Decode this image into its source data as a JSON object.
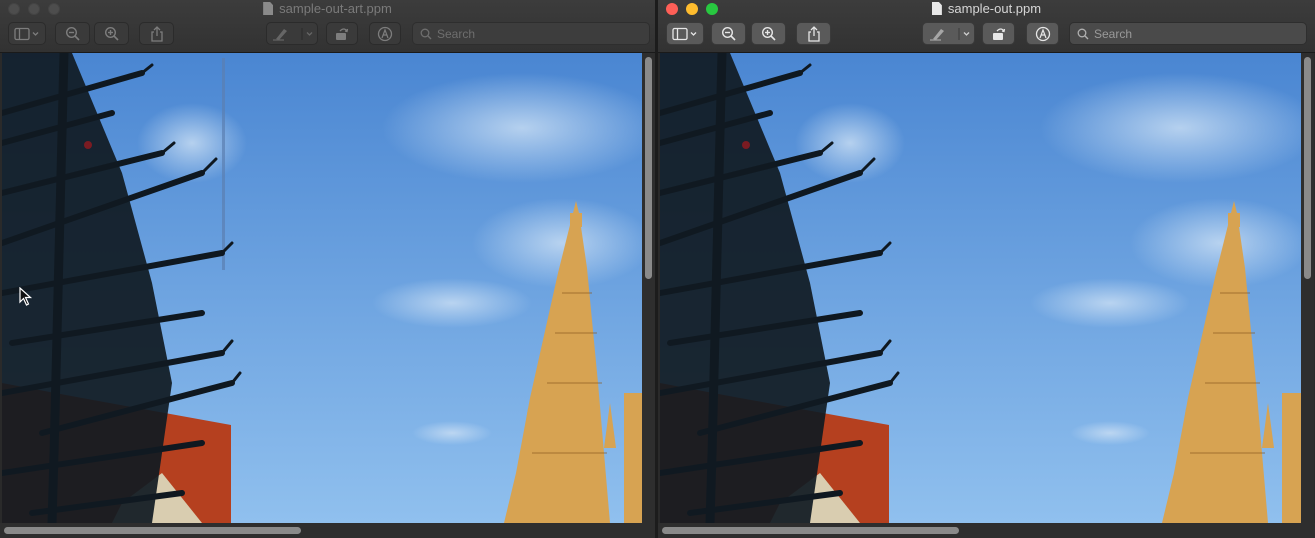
{
  "windows": [
    {
      "state": "inactive",
      "title": "sample-out-art.ppm",
      "search_placeholder": "Search"
    },
    {
      "state": "active",
      "title": "sample-out.ppm",
      "search_placeholder": "Search"
    }
  ],
  "toolbar_icons": [
    "sidebar-toggle-icon",
    "chevron-down-icon",
    "zoom-out-icon",
    "zoom-in-icon",
    "share-icon",
    "highlighter-icon",
    "rotate-icon",
    "markup-icon",
    "search-icon"
  ],
  "colors": {
    "sky_top": "#4f8cd6",
    "sky_bottom": "#8fbfef",
    "spire": "#d9a85a",
    "roof": "#b23e22",
    "tree": "#101820",
    "close": "#fe5f57",
    "minimize": "#febc2e",
    "maximize": "#28c840"
  }
}
